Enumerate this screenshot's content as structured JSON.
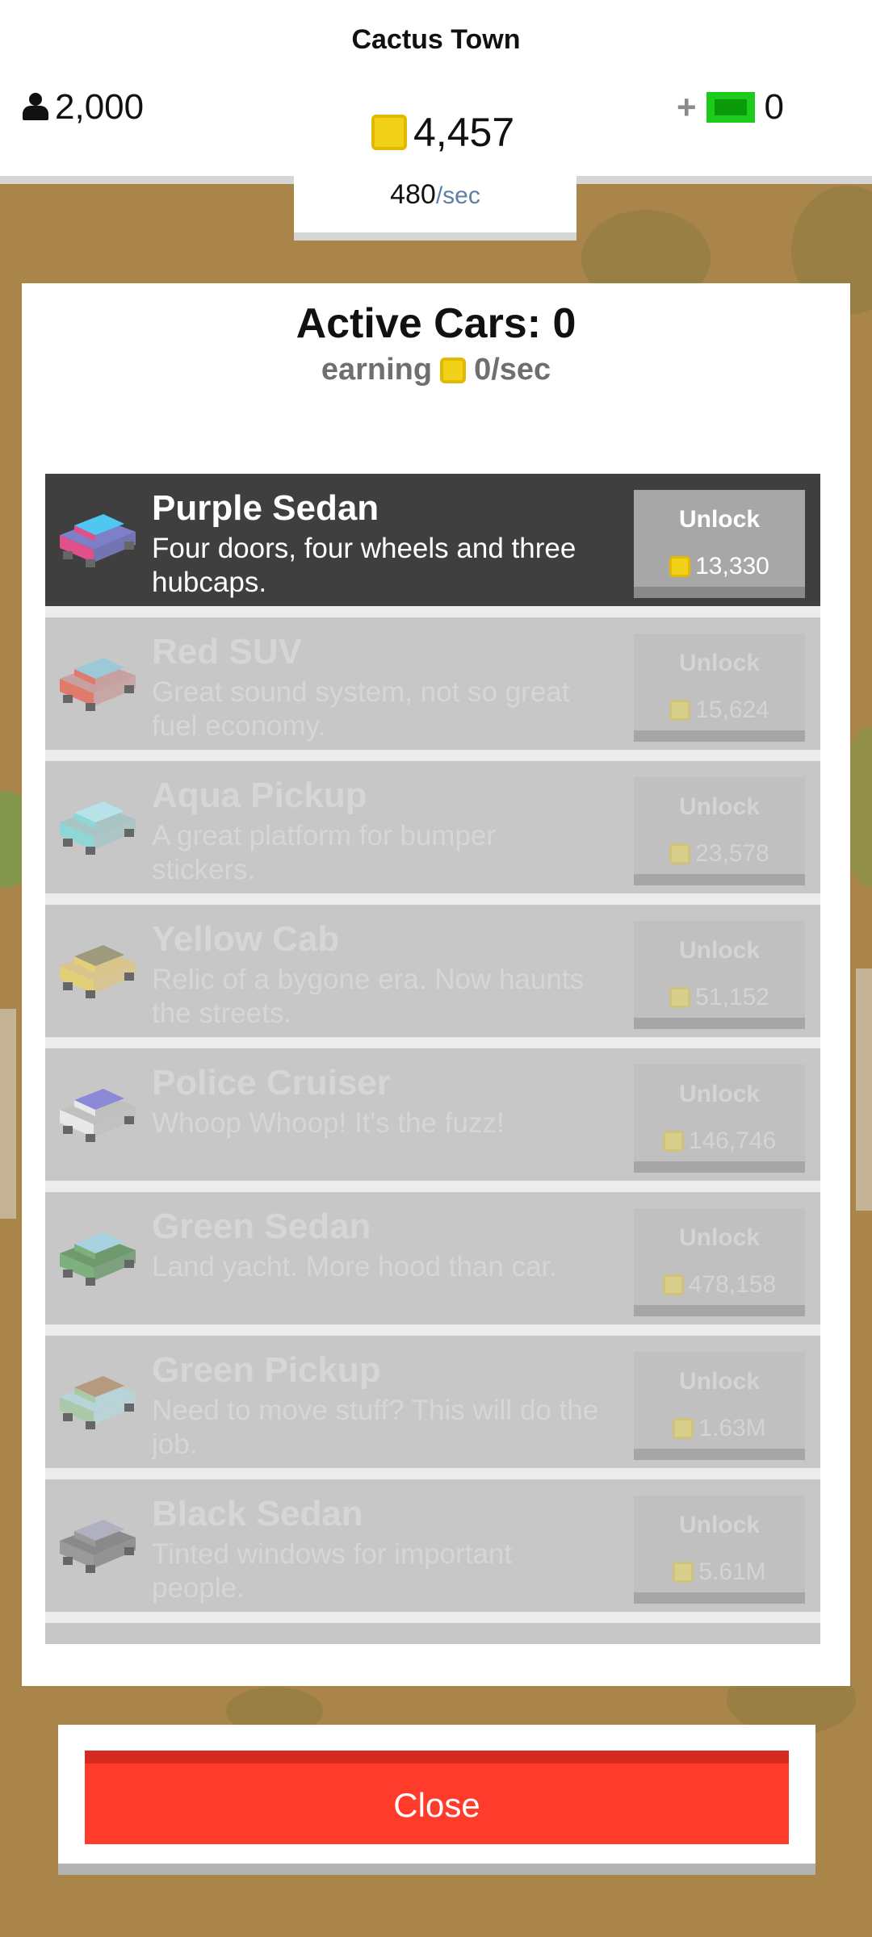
{
  "header": {
    "town_name": "Cactus Town",
    "population": "2,000",
    "coins": "4,457",
    "cash_plus": "+",
    "cash": "0",
    "rate_value": "480",
    "rate_unit": "/sec"
  },
  "panel": {
    "title": "Active Cars: 0",
    "earning_label": "earning",
    "earning_value": "0/sec"
  },
  "cars": [
    {
      "name": "Purple Sedan",
      "desc": "Four doors, four wheels and three hubcaps.",
      "button": "Unlock",
      "price": "13,330",
      "colors": [
        "#e0508a",
        "#4fc7f0",
        "#7d7fc8"
      ]
    },
    {
      "name": "Red SUV",
      "desc": "Great sound system, not so great fuel economy.",
      "button": "Unlock",
      "price": "15,624",
      "colors": [
        "#e07a6a",
        "#9cc9d8",
        "#c7a1a0"
      ]
    },
    {
      "name": "Aqua Pickup",
      "desc": "A great platform for bumper stickers.",
      "button": "Unlock",
      "price": "23,578",
      "colors": [
        "#8fd6d6",
        "#b7e3e8",
        "#a9c4c4"
      ]
    },
    {
      "name": "Yellow Cab",
      "desc": "Relic of a bygone era. Now haunts the streets.",
      "button": "Unlock",
      "price": "51,152",
      "colors": [
        "#e3cf7a",
        "#9e9a7e",
        "#d9c48b"
      ]
    },
    {
      "name": "Police Cruiser",
      "desc": "Whoop Whoop! It's the fuzz!",
      "button": "Unlock",
      "price": "146,746",
      "colors": [
        "#e8e8e8",
        "#8a8ad6",
        "#c0c0c0"
      ]
    },
    {
      "name": "Green Sedan",
      "desc": "Land yacht. More hood than car.",
      "button": "Unlock",
      "price": "478,158",
      "colors": [
        "#7eb07e",
        "#a8d2e0",
        "#6e9a6e"
      ]
    },
    {
      "name": "Green Pickup",
      "desc": "Need to move stuff? This will do the job.",
      "button": "Unlock",
      "price": "1.63M",
      "colors": [
        "#a9c9a9",
        "#b59a7e",
        "#b8d4d8"
      ]
    },
    {
      "name": "Black Sedan",
      "desc": "Tinted windows for important people.",
      "button": "Unlock",
      "price": "5.61M",
      "colors": [
        "#9a9a9a",
        "#b0b0c0",
        "#8a8a8a"
      ]
    }
  ],
  "close_label": "Close",
  "icons": {
    "population": "person-icon",
    "coin": "coin-icon",
    "cash": "cash-icon",
    "car": "car-icon"
  }
}
